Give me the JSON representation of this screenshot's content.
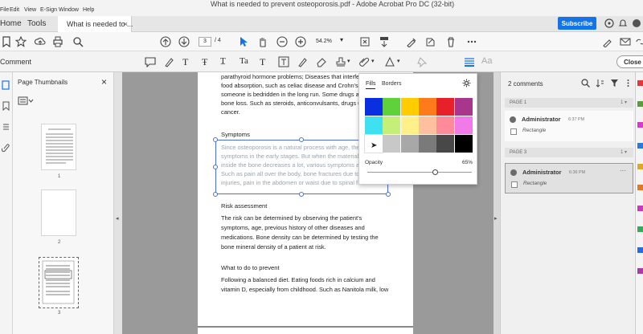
{
  "window": {
    "title": "What is needed to prevent osteoporosis.pdf - Adobe Acrobat Pro DC (32-bit)"
  },
  "menu": [
    "File",
    "Edit",
    "View",
    "E-Sign",
    "Window",
    "Help"
  ],
  "nav": {
    "home": "Home",
    "tools": "Tools",
    "tab_label": "What is needed to ...",
    "tab_close": "×",
    "subscribe": "Subscribe"
  },
  "toolbar": {
    "current_page": "3",
    "total_pages": "/ 4",
    "zoom": "54.2%"
  },
  "comment_toolbar": {
    "label": "Comment",
    "close": "Close",
    "text_tool": "Aa"
  },
  "thumbnails": {
    "header": "Page Thumbnails",
    "close": "×",
    "pages": [
      "1",
      "2",
      "3"
    ]
  },
  "document": {
    "intro_lines": [
      "parathyroid hormone problems; Diseases that interfe",
      "food absorption, such as celiac disease and Crohn's d",
      "someone is bedridden in the long run. Some drugs al",
      "bone loss. Such as steroids, anticonvulsants, drugs us",
      "cancer."
    ],
    "symptoms_heading": "Symptoms",
    "symptoms_lines": [
      "Since osteoporosis is a natural process with age, then",
      "symptoms in the early stages. But when the material",
      "inside the bone decreases a lot, various symptoms ar",
      "Such as pain all over the body, bone fractures due to",
      "injuries, pain in the abdomen or waist due to spinal f"
    ],
    "risk_heading": "Risk assessment",
    "risk_lines": [
      "The risk can be determined by observing the patient's",
      "symptoms, age, previous history of other diseases and",
      "medications. Bone density can be determined by testing the",
      "bone mineral density of a patient at risk."
    ],
    "prevent_heading": "What to do to prevent",
    "prevent_lines": [
      "Following a balanced diet. Eating foods rich in calcium and",
      "vitamin D, especially from childhood. Such as Nanitola milk, low"
    ]
  },
  "color_popup": {
    "fills_tab": "Fills",
    "borders_tab": "Borders",
    "opacity_label": "Opacity",
    "opacity_value": "65%",
    "opacity_fraction": 0.65,
    "swatch_colors": [
      "#0a2fe0",
      "#5fd13a",
      "#ffcc00",
      "#ff7a1a",
      "#e8202a",
      "#a8368c",
      "#3fe0f0",
      "#c4f07a",
      "#fff08a",
      "#ffc0a0",
      "#ff8a9a",
      "#f07ae8",
      "#ffffff",
      "#c8c8c8",
      "#a8a8a8",
      "#7a7a7a",
      "#484848",
      "#000000"
    ]
  },
  "comments_panel": {
    "count": "2 comments",
    "groups": [
      {
        "page": "PAGE 1",
        "author": "Administrator",
        "time": "6:37 PM",
        "type": "Rectangle",
        "selected": false
      },
      {
        "page": "PAGE 3",
        "author": "Administrator",
        "time": "6:36 PM",
        "type": "Rectangle",
        "selected": true
      }
    ]
  },
  "colors": {
    "accent": "#1473e6",
    "selection": "#4f6fcf"
  }
}
